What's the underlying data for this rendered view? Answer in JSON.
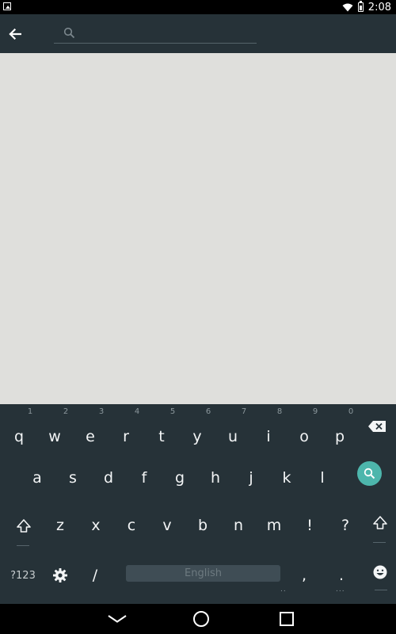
{
  "status_bar": {
    "time": "2:08",
    "battery_level": 0.8
  },
  "search": {
    "placeholder": "",
    "value": ""
  },
  "keyboard": {
    "row1": [
      {
        "label": "q",
        "hint": "1"
      },
      {
        "label": "w",
        "hint": "2"
      },
      {
        "label": "e",
        "hint": "3"
      },
      {
        "label": "r",
        "hint": "4"
      },
      {
        "label": "t",
        "hint": "5"
      },
      {
        "label": "y",
        "hint": "6"
      },
      {
        "label": "u",
        "hint": "7"
      },
      {
        "label": "i",
        "hint": "8"
      },
      {
        "label": "o",
        "hint": "9"
      },
      {
        "label": "p",
        "hint": "0"
      }
    ],
    "row2": [
      "a",
      "s",
      "d",
      "f",
      "g",
      "h",
      "j",
      "k",
      "l"
    ],
    "row3": [
      "z",
      "x",
      "c",
      "v",
      "b",
      "n",
      "m",
      "!",
      "?"
    ],
    "symbols_label": "?123",
    "slash_label": "/",
    "space_label": "English",
    "comma_label": ",",
    "period_label": ".",
    "accent_color": "#4db6ac"
  }
}
